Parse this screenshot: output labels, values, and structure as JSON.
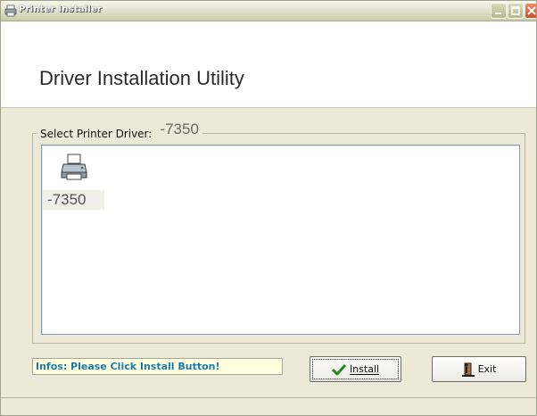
{
  "window": {
    "title": "Printer Installer",
    "controls": {
      "minimize": "minimize-icon",
      "maximize": "maximize-icon",
      "close": "close-icon"
    }
  },
  "header": {
    "title": "Driver Installation Utility"
  },
  "driver_group": {
    "label": "Select Printer Driver:",
    "selected_value": "-7350",
    "items": [
      {
        "label": "-7350",
        "icon": "printer-icon"
      }
    ]
  },
  "infos": {
    "text": "Infos: Please Click Install Button!"
  },
  "buttons": {
    "install": {
      "label": "Install",
      "icon": "checkmark-icon"
    },
    "exit": {
      "label": "Exit",
      "icon": "exit-door-icon"
    }
  },
  "colors": {
    "info_text": "#1a7aa8",
    "info_bg": "#ffffe0",
    "window_bg": "#ece9d8"
  }
}
